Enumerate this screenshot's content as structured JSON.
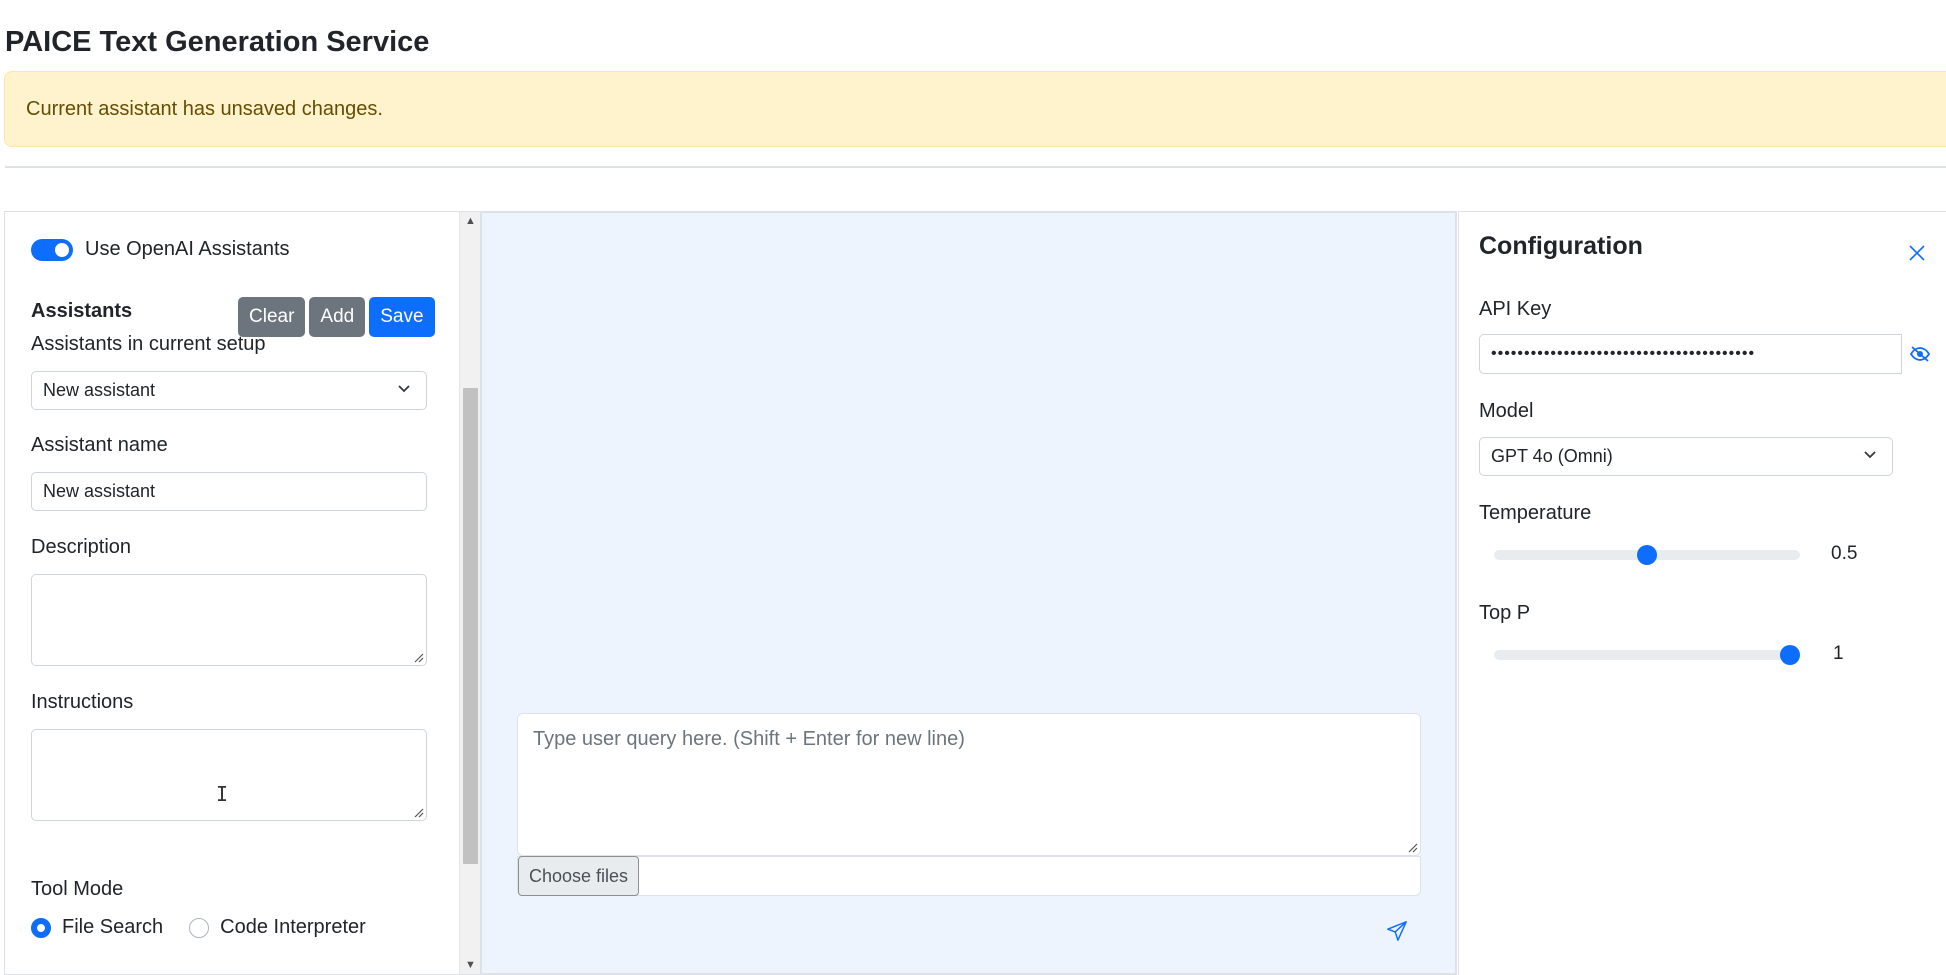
{
  "page": {
    "title": "PAICE Text Generation Service",
    "alert": "Current assistant has unsaved changes."
  },
  "left": {
    "toggle_label": "Use OpenAI Assistants",
    "toggle_on": true,
    "assistants_title": "Assistants",
    "buttons": {
      "clear": "Clear",
      "add": "Add",
      "save": "Save"
    },
    "current_setup_label": "Assistants in current setup",
    "current_setup_value": "New assistant",
    "name_label": "Assistant name",
    "name_value": "New assistant",
    "description_label": "Description",
    "description_value": "",
    "instructions_label": "Instructions",
    "instructions_value": "",
    "tool_mode_label": "Tool Mode",
    "tool_modes": [
      {
        "label": "File Search",
        "checked": true
      },
      {
        "label": "Code Interpreter",
        "checked": false
      }
    ]
  },
  "center": {
    "query_placeholder": "Type user query here. (Shift + Enter for new line)",
    "choose_files": "Choose files",
    "send_icon": "send-icon"
  },
  "config": {
    "title": "Configuration",
    "api_key_label": "API Key",
    "api_key_value": "••••••••••••••••••••••••••••••••••••••••",
    "model_label": "Model",
    "model_value": "GPT 4o (Omni)",
    "temperature_label": "Temperature",
    "temperature_value": "0.5",
    "temperature_fraction": 0.5,
    "top_p_label": "Top P",
    "top_p_value": "1",
    "top_p_fraction": 1
  },
  "colors": {
    "primary": "#0d6efd",
    "secondary": "#6c757d",
    "alert_bg": "#fff3cd",
    "alert_text": "#664d03",
    "chat_bg": "#eef4fd"
  }
}
